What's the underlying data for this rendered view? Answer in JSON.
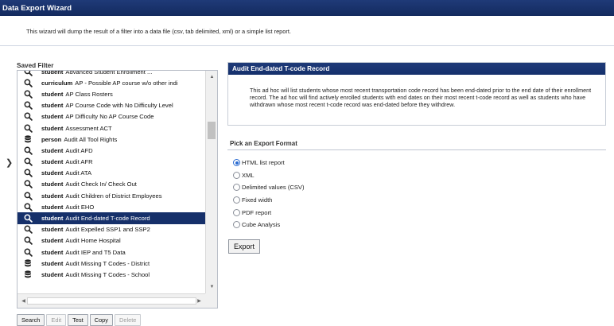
{
  "header": {
    "title": "Data Export Wizard"
  },
  "intro": {
    "text": "This wizard will dump the result of a filter into a data file (csv, tab delimited, xml) or a simple list report."
  },
  "saved_filter": {
    "label": "Saved Filter",
    "items": [
      {
        "icon": "search-icon",
        "category": "student",
        "name": "Advanced Student Enrollment ..."
      },
      {
        "icon": "search-icon",
        "category": "curriculum",
        "name": "AP - Possible AP course w/o other indi"
      },
      {
        "icon": "search-icon",
        "category": "student",
        "name": "AP Class Rosters"
      },
      {
        "icon": "search-icon",
        "category": "student",
        "name": "AP Course Code with No Difficulty Level"
      },
      {
        "icon": "search-icon",
        "category": "student",
        "name": "AP Difficulty No AP Course Code"
      },
      {
        "icon": "search-icon",
        "category": "student",
        "name": "Assessment ACT"
      },
      {
        "icon": "database-icon",
        "category": "person",
        "name": "Audit All Tool Rights"
      },
      {
        "icon": "search-icon",
        "category": "student",
        "name": "Audit AFD"
      },
      {
        "icon": "search-icon",
        "category": "student",
        "name": "Audit AFR"
      },
      {
        "icon": "search-icon",
        "category": "student",
        "name": "Audit ATA"
      },
      {
        "icon": "search-icon",
        "category": "student",
        "name": "Audit Check In/ Check Out"
      },
      {
        "icon": "search-icon",
        "category": "student",
        "name": "Audit Children of District Employees"
      },
      {
        "icon": "search-icon",
        "category": "student",
        "name": "Audit EHO"
      },
      {
        "icon": "search-icon",
        "category": "student",
        "name": "Audit End-dated T-code Record",
        "selected": true
      },
      {
        "icon": "search-icon",
        "category": "student",
        "name": "Audit Expelled SSP1 and SSP2"
      },
      {
        "icon": "search-icon",
        "category": "student",
        "name": "Audit Home Hospital"
      },
      {
        "icon": "search-icon",
        "category": "student",
        "name": "Audit IEP and T5 Data"
      },
      {
        "icon": "database-icon",
        "category": "student",
        "name": "Audit Missing T Codes - District"
      },
      {
        "icon": "database-icon",
        "category": "student",
        "name": "Audit Missing T Codes - School"
      }
    ]
  },
  "buttons": {
    "search": "Search",
    "edit": "Edit",
    "test": "Test",
    "copy": "Copy",
    "delete": "Delete"
  },
  "detail": {
    "title": "Audit End-dated T-code Record",
    "description": "This ad hoc will list students whose most recent transportation code record has been end-dated prior to the end date of their enrollment record. The ad hoc will find actively enrolled students with end dates on their most recent t-code record as well as students who have withdrawn whose most recent t-code record was end-dated before they withdrew."
  },
  "export": {
    "label": "Pick an Export Format",
    "formats": [
      {
        "label": "HTML list report",
        "checked": true
      },
      {
        "label": "XML",
        "checked": false
      },
      {
        "label": "Delimited values (CSV)",
        "checked": false
      },
      {
        "label": "Fixed width",
        "checked": false
      },
      {
        "label": "PDF report",
        "checked": false
      },
      {
        "label": "Cube Analysis",
        "checked": false
      }
    ],
    "button": "Export"
  },
  "colors": {
    "header_bg": "#1f3a78",
    "selected_row_bg": "#16306a",
    "radio_accent": "#2a6bd1"
  }
}
